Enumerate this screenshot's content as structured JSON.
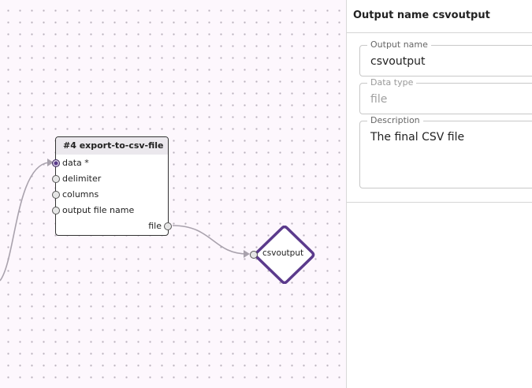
{
  "canvas": {
    "step_node": {
      "title": "#4 export-to-csv-file",
      "inputs": [
        {
          "label": "data",
          "required_marker": "*",
          "connected": true
        },
        {
          "label": "delimiter",
          "connected": false
        },
        {
          "label": "columns",
          "connected": false
        },
        {
          "label": "output file name",
          "connected": false
        }
      ],
      "output": {
        "label": "file"
      }
    },
    "output_node": {
      "label": "csvoutput",
      "color": "#5b3a8c"
    },
    "accent_color": "#5b3a8c",
    "edge_color": "#a9a2ad"
  },
  "sidebar": {
    "title": "Output name csvoutput",
    "fields": {
      "output_name": {
        "label": "Output name",
        "value": "csvoutput"
      },
      "data_type": {
        "label": "Data type",
        "value": "file"
      },
      "description": {
        "label": "Description",
        "value": "The final CSV file"
      }
    }
  }
}
